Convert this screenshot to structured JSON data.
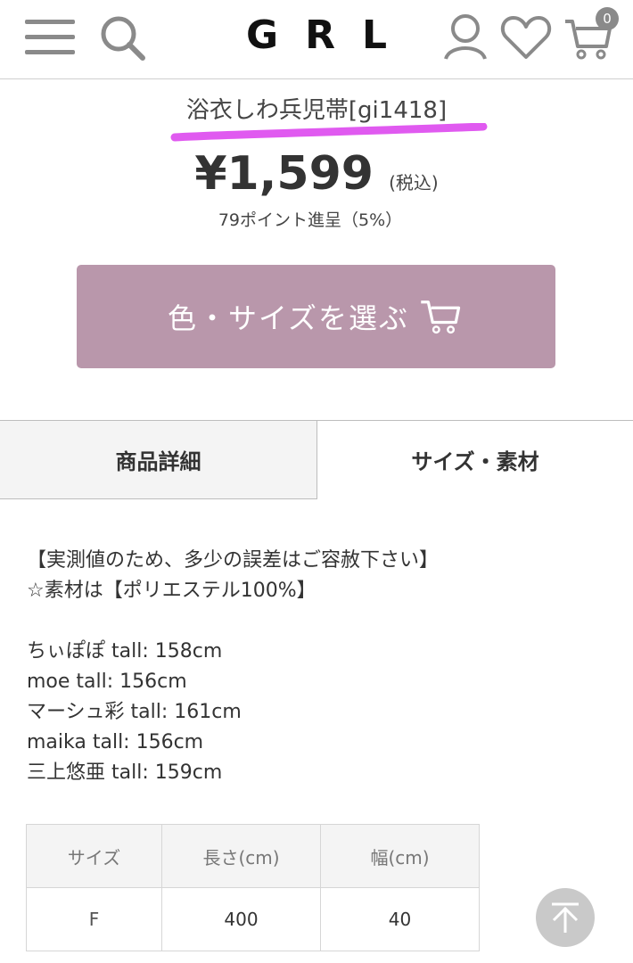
{
  "header": {
    "logo": "GRL",
    "cart_count": "0",
    "icons": [
      "menu-icon",
      "search-icon",
      "user-icon",
      "heart-icon",
      "cart-icon"
    ]
  },
  "product": {
    "title": "浴衣しわ兵児帯[gi1418]",
    "price": "¥1,599",
    "tax_note": "(税込)",
    "points": "79ポイント進呈（5%）"
  },
  "select_button": {
    "label": "色・サイズを選ぶ"
  },
  "tabs": [
    {
      "label": "商品詳細"
    },
    {
      "label": "サイズ・素材"
    }
  ],
  "description": {
    "lines": [
      "【実測値のため、多少の誤差はご容赦下さい】",
      "☆素材は【ポリエステル100%】",
      "",
      "ちぃぽぽ tall: 158cm",
      "moe tall: 156cm",
      "マーシュ彩 tall: 161cm",
      "maika tall: 156cm",
      "三上悠亜 tall: 159cm"
    ]
  },
  "size_table": {
    "headers": [
      "サイズ",
      "長さ(cm)",
      "幅(cm)"
    ],
    "rows": [
      [
        "F",
        "400",
        "40"
      ]
    ]
  },
  "colors": {
    "button": "#b997ab",
    "highlight": "#e05af0",
    "tab_inactive_bg": "#f4f4f4"
  }
}
